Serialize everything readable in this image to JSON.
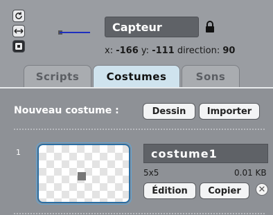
{
  "sprite": {
    "name": "Capteur",
    "x_label": "x:",
    "x_value": "-166",
    "y_label": "y:",
    "y_value": "-111",
    "direction_label": "direction:",
    "direction_value": "90"
  },
  "rotation_styles": [
    {
      "icon": "rotate-icon"
    },
    {
      "icon": "flip-left-right-icon"
    },
    {
      "icon": "no-rotate-icon"
    }
  ],
  "tabs": [
    {
      "label": "Scripts",
      "active": false
    },
    {
      "label": "Costumes",
      "active": true
    },
    {
      "label": "Sons",
      "active": false
    }
  ],
  "costumes_panel": {
    "new_costume_label": "Nouveau costume :",
    "paint_button": "Dessin",
    "import_button": "Importer",
    "costumes": [
      {
        "number": "1",
        "name": "costume1",
        "size": "5x5",
        "file_size": "0.01 KB",
        "edit_button": "Édition",
        "copy_button": "Copier"
      }
    ]
  },
  "colors": {
    "accent": "#cfe3ee",
    "name_field": "#5f6267",
    "thumbnail_border": "#2a6ea3"
  }
}
